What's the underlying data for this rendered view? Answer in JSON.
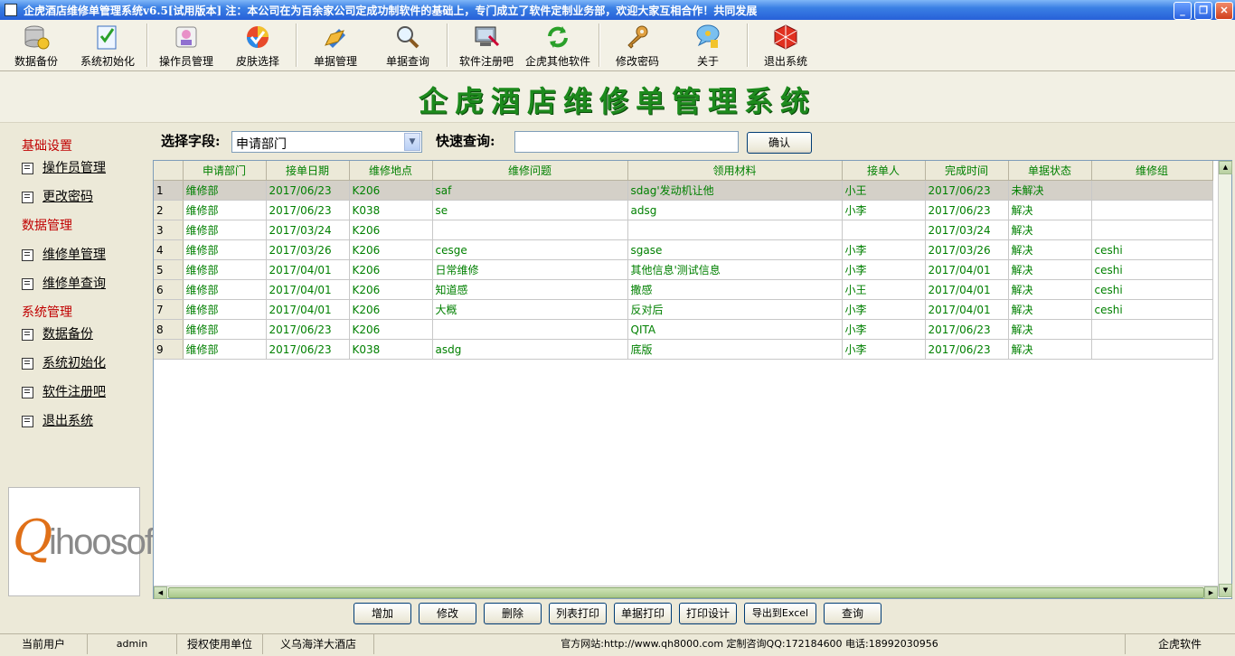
{
  "window": {
    "title": "企虎酒店维修单管理系统v6.5[试用版本] 注：本公司在为百余家公司定成功制软件的基础上，专门成立了软件定制业务部，欢迎大家互相合作！共同发展"
  },
  "toolbar": {
    "items": [
      {
        "label": "数据备份",
        "icon": "database-icon"
      },
      {
        "label": "系统初始化",
        "icon": "checklist-icon"
      },
      {
        "label": "操作员管理",
        "icon": "operator-icon"
      },
      {
        "label": "皮肤选择",
        "icon": "skin-icon"
      },
      {
        "label": "单据管理",
        "icon": "documents-icon"
      },
      {
        "label": "单据查询",
        "icon": "magnifier-icon"
      },
      {
        "label": "软件注册吧",
        "icon": "register-icon"
      },
      {
        "label": "企虎其他软件",
        "icon": "refresh-icon"
      },
      {
        "label": "修改密码",
        "icon": "key-icon"
      },
      {
        "label": "关于",
        "icon": "about-icon"
      },
      {
        "label": "退出系统",
        "icon": "exit-icon"
      }
    ]
  },
  "banner": {
    "title": "企虎酒店维修单管理系统"
  },
  "sidebar": {
    "groups": [
      {
        "heading": "基础设置",
        "items": [
          "操作员管理",
          "更改密码"
        ]
      },
      {
        "heading": "数据管理",
        "items": [
          "维修单管理",
          "维修单查询"
        ]
      },
      {
        "heading": "系统管理",
        "items": [
          "数据备份",
          "系统初始化",
          "软件注册吧",
          "退出系统"
        ]
      }
    ],
    "logo_q": "Q",
    "logo_rest": "ihoosoft"
  },
  "search": {
    "field_label": "选择字段:",
    "field_value": "申请部门",
    "quick_label": "快速查询:",
    "quick_value": "",
    "confirm_label": "确认"
  },
  "grid": {
    "columns": [
      "申请部门",
      "接单日期",
      "维修地点",
      "维修问题",
      "领用材料",
      "接单人",
      "完成时间",
      "单据状态",
      "维修组"
    ],
    "rows": [
      [
        "1",
        "维修部",
        "2017/06/23",
        "K206",
        "saf",
        "sdag'发动机让他",
        "小王",
        "2017/06/23",
        "未解决",
        ""
      ],
      [
        "2",
        "维修部",
        "2017/06/23",
        "K038",
        "se",
        "adsg",
        "小李",
        "2017/06/23",
        "解决",
        ""
      ],
      [
        "3",
        "维修部",
        "2017/03/24",
        "K206",
        "",
        "",
        "",
        "2017/03/24",
        "解决",
        ""
      ],
      [
        "4",
        "维修部",
        "2017/03/26",
        "K206",
        "cesge",
        "sgase",
        "小李",
        "2017/03/26",
        "解决",
        "ceshi"
      ],
      [
        "5",
        "维修部",
        "2017/04/01",
        "K206",
        "日常维修",
        "其他信息'测试信息",
        "小李",
        "2017/04/01",
        "解决",
        "ceshi"
      ],
      [
        "6",
        "维修部",
        "2017/04/01",
        "K206",
        "知道感",
        "撒感",
        "小王",
        "2017/04/01",
        "解决",
        "ceshi"
      ],
      [
        "7",
        "维修部",
        "2017/04/01",
        "K206",
        "大概",
        "反对后",
        "小李",
        "2017/04/01",
        "解决",
        "ceshi"
      ],
      [
        "8",
        "维修部",
        "2017/06/23",
        "K206",
        "",
        "QITA",
        "小李",
        "2017/06/23",
        "解决",
        ""
      ],
      [
        "9",
        "维修部",
        "2017/06/23",
        "K038",
        "asdg",
        "底版",
        "小李",
        "2017/06/23",
        "解决",
        ""
      ]
    ]
  },
  "actions": [
    "增加",
    "修改",
    "删除",
    "列表打印",
    "单据打印",
    "打印设计",
    "导出到Excel",
    "查询"
  ],
  "status": {
    "user_label": "当前用户",
    "user_value": "admin",
    "unit_label": "授权使用单位",
    "unit_value": "义乌海洋大酒店",
    "site": "官方网站:http://www.qh8000.com 定制咨询QQ:172184600 电话:18992030956",
    "brand": "企虎软件"
  },
  "colors": {
    "grid_text": "#008000",
    "banner_text": "#1d8a1d",
    "sidebar_heading": "#c00000",
    "titlebar": "#2760d8"
  }
}
